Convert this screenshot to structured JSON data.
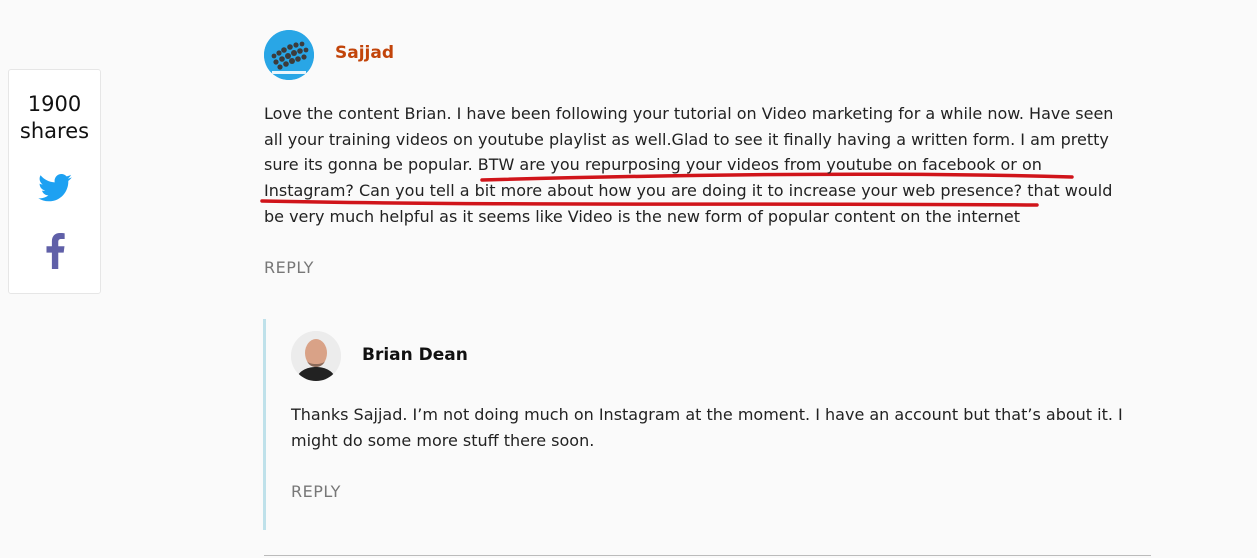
{
  "share_panel": {
    "count": "1900",
    "label": "shares",
    "twitter_color": "#1da1f2",
    "facebook_color": "#6060a8"
  },
  "comments": [
    {
      "author": "Sajjad",
      "author_color": "#c2440a",
      "lines": [
        "Love the content Brian. I have been following your tutorial on Video marketing for a while now. Have seen",
        "all your training videos on youtube playlist as well.Glad to see it finally having a written form. I am pretty",
        "sure its gonna be popular. BTW are you repurposing your videos from youtube on facebook or on",
        "Instagram? Can you tell a bit more about how you are doing it to increase your web presence? that would",
        "be very much helpful as it seems like Video is the new form of popular content on the internet"
      ],
      "reply_label": "REPLY"
    },
    {
      "author": "Brian Dean",
      "lines": [
        "Thanks Sajjad. I’m not doing much on Instagram at the moment. I have an account but that’s about it. I",
        "might do some more stuff there soon."
      ],
      "reply_label": "REPLY"
    }
  ],
  "annotation_color": "#d0141a"
}
